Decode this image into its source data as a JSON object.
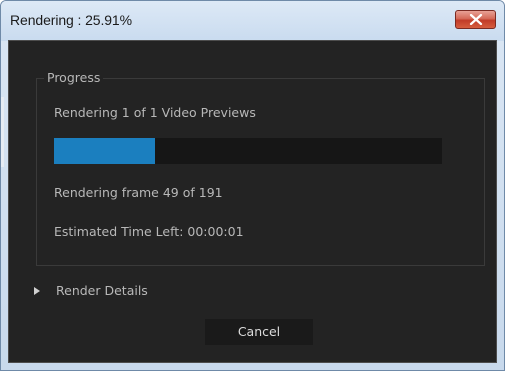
{
  "window": {
    "title": "Rendering : 25.91%"
  },
  "progress_group": {
    "label": "Progress",
    "rendering_line": "Rendering 1 of 1 Video Previews",
    "progress_fraction": 0.2591,
    "frame_line": "Rendering frame 49 of 191",
    "time_left": "Estimated Time Left: 00:00:01"
  },
  "details": {
    "label": "Render Details"
  },
  "buttons": {
    "cancel": "Cancel"
  },
  "icons": {
    "close": "close-icon",
    "expand": "disclosure-triangle-icon"
  },
  "colors": {
    "progress_fill": "#1b7fbf",
    "panel_background": "#232323",
    "close_button": "#c7432f"
  }
}
